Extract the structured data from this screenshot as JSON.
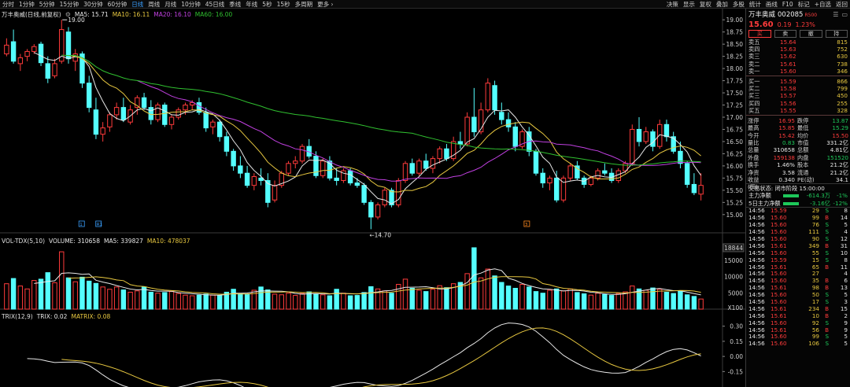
{
  "toolbar": {
    "items": [
      "分时",
      "1分钟",
      "5分钟",
      "15分钟",
      "30分钟",
      "60分钟",
      "日线",
      "周线",
      "月线",
      "10分钟",
      "45日线",
      "季线",
      "年线",
      "5秒",
      "15秒",
      "多周期",
      "更多 ›"
    ],
    "active_index": 6,
    "right_items": [
      "决策",
      "显示",
      "复权",
      "叠加",
      "多股",
      "统计",
      "画线",
      "F10",
      "标记",
      "+自选",
      "返回"
    ]
  },
  "kline": {
    "title": "万丰奥威(日线,前复权)",
    "ma_labels": [
      {
        "text": "MA5: 15.71",
        "color": "#e8e8e8"
      },
      {
        "text": "MA10: 16.11",
        "color": "#e8c840"
      },
      {
        "text": "MA20: 16.10",
        "color": "#c040e0"
      },
      {
        "text": "MA60: 16.00",
        "color": "#30c030"
      }
    ],
    "y_ticks": [
      "19.00",
      "18.75",
      "18.50",
      "18.25",
      "18.00",
      "17.75",
      "17.50",
      "17.25",
      "17.00",
      "16.75",
      "16.50",
      "16.25",
      "16.00",
      "15.75",
      "15.50",
      "15.25",
      "15.00"
    ],
    "high_label": "19.00",
    "low_label": "←14.70",
    "marks": [
      "1",
      "R1",
      "3"
    ]
  },
  "volume": {
    "title": "VOL-TDX(5,10)",
    "labels": [
      {
        "text": "VOLUME: 310658",
        "color": "#e8e8e8"
      },
      {
        "text": "MA5: 339827",
        "color": "#e8e8e8"
      },
      {
        "text": "MA10: 478037",
        "color": "#e8c840"
      }
    ],
    "y_ticks": [
      "18844",
      "15000",
      "10000",
      "5000",
      "X100"
    ]
  },
  "trix": {
    "title": "TRIX(12,9)",
    "labels": [
      {
        "text": "TRIX: 0.02",
        "color": "#e8e8e8"
      },
      {
        "text": "MATRIX: 0.08",
        "color": "#e8c840"
      }
    ],
    "y_ticks": [
      "0.30",
      "0.15",
      "0.00",
      "-0.15"
    ]
  },
  "quote": {
    "name": "万丰奥威",
    "code": "002085",
    "tag": "R500",
    "price": "15.60",
    "change": "0.19",
    "pct": "1.23%",
    "tabs": [
      "买",
      "卖",
      "撤",
      "持"
    ],
    "asks": [
      {
        "label": "卖五",
        "price": "15.64",
        "vol": "815"
      },
      {
        "label": "卖四",
        "price": "15.63",
        "vol": "752"
      },
      {
        "label": "卖三",
        "price": "15.62",
        "vol": "630"
      },
      {
        "label": "卖二",
        "price": "15.61",
        "vol": "738"
      },
      {
        "label": "卖一",
        "price": "15.60",
        "vol": "346"
      }
    ],
    "bids": [
      {
        "label": "买一",
        "price": "15.59",
        "vol": "866"
      },
      {
        "label": "买二",
        "price": "15.58",
        "vol": "799"
      },
      {
        "label": "买三",
        "price": "15.57",
        "vol": "450"
      },
      {
        "label": "买四",
        "price": "15.56",
        "vol": "255"
      },
      {
        "label": "买五",
        "price": "15.55",
        "vol": "328"
      }
    ],
    "stats": [
      {
        "l1": "涨停",
        "v1": "16.95",
        "c1": "red",
        "l2": "跌停",
        "v2": "13.87",
        "c2": "green"
      },
      {
        "l1": "最高",
        "v1": "15.85",
        "c1": "red",
        "l2": "最低",
        "v2": "15.29",
        "c2": "green"
      },
      {
        "l1": "今开",
        "v1": "15.42",
        "c1": "red",
        "l2": "均价",
        "v2": "15.50",
        "c2": "red"
      },
      {
        "l1": "量比",
        "v1": "0.83",
        "c1": "green",
        "l2": "市值",
        "v2": "331.2亿",
        "c2": "white"
      },
      {
        "l1": "总量",
        "v1": "310658",
        "c1": "white",
        "l2": "总额",
        "v2": "4.81亿",
        "c2": "white"
      },
      {
        "l1": "外盘",
        "v1": "159138",
        "c1": "red",
        "l2": "内盘",
        "v2": "151520",
        "c2": "green"
      },
      {
        "l1": "换手",
        "v1": "1.46%",
        "c1": "white",
        "l2": "股本",
        "v2": "21.2亿",
        "c2": "white"
      },
      {
        "l1": "净资",
        "v1": "3.58",
        "c1": "white",
        "l2": "流通",
        "v2": "21.2亿",
        "c2": "white"
      },
      {
        "l1": "收益(四)",
        "v1": "0.340",
        "c1": "white",
        "l2": "PE(动)",
        "v2": "34.1",
        "c2": "white"
      }
    ],
    "status": "交易状态: 闭市阶段 15:00:00",
    "flows": [
      {
        "label": "主力净额",
        "value": "-614.3万",
        "pct": "-1%",
        "color": "#1ec85a"
      },
      {
        "label": "5日主力净额",
        "value": "-3.16亿",
        "pct": "-12%",
        "color": "#1ec85a"
      }
    ],
    "ticks": [
      {
        "t": "14:56",
        "p": "15.59",
        "v": "29",
        "d": "S",
        "n": "8"
      },
      {
        "t": "14:56",
        "p": "15.60",
        "v": "99",
        "d": "B",
        "n": "14"
      },
      {
        "t": "14:56",
        "p": "15.60",
        "v": "76",
        "d": "S",
        "n": "5"
      },
      {
        "t": "14:56",
        "p": "15.60",
        "v": "111",
        "d": "S",
        "n": "4"
      },
      {
        "t": "14:56",
        "p": "15.60",
        "v": "90",
        "d": "S",
        "n": "12"
      },
      {
        "t": "14:56",
        "p": "15.61",
        "v": "349",
        "d": "B",
        "n": "31"
      },
      {
        "t": "14:56",
        "p": "15.60",
        "v": "55",
        "d": "S",
        "n": "10"
      },
      {
        "t": "14:56",
        "p": "15.59",
        "v": "15",
        "d": "S",
        "n": "8"
      },
      {
        "t": "14:56",
        "p": "15.61",
        "v": "65",
        "d": "B",
        "n": "11"
      },
      {
        "t": "14:56",
        "p": "15.60",
        "v": "27",
        "d": "",
        "n": "4"
      },
      {
        "t": "14:56",
        "p": "15.60",
        "v": "35",
        "d": "B",
        "n": "6"
      },
      {
        "t": "14:56",
        "p": "15.61",
        "v": "98",
        "d": "B",
        "n": "13"
      },
      {
        "t": "14:56",
        "p": "15.60",
        "v": "50",
        "d": "S",
        "n": "5"
      },
      {
        "t": "14:56",
        "p": "15.60",
        "v": "17",
        "d": "S",
        "n": "3"
      },
      {
        "t": "14:56",
        "p": "15.61",
        "v": "234",
        "d": "B",
        "n": "15"
      },
      {
        "t": "14:56",
        "p": "15.61",
        "v": "10",
        "d": "B",
        "n": "2"
      },
      {
        "t": "14:56",
        "p": "15.60",
        "v": "92",
        "d": "S",
        "n": "9"
      },
      {
        "t": "14:56",
        "p": "15.61",
        "v": "56",
        "d": "B",
        "n": "9"
      },
      {
        "t": "14:56",
        "p": "15.60",
        "v": "99",
        "d": "S",
        "n": "5"
      },
      {
        "t": "14:56",
        "p": "15.60",
        "v": "106",
        "d": "S",
        "n": "5"
      }
    ]
  },
  "chart_data": {
    "type": "candlestick",
    "y_range": [
      14.9,
      19.1
    ],
    "ohlc": [
      [
        18.3,
        18.62,
        18.25,
        18.48
      ],
      [
        18.55,
        18.8,
        18.1,
        18.15
      ],
      [
        18.1,
        18.3,
        17.95,
        18.22
      ],
      [
        18.25,
        18.4,
        18.15,
        18.35
      ],
      [
        18.35,
        18.5,
        18.3,
        18.45
      ],
      [
        18.5,
        18.55,
        18.05,
        18.12
      ],
      [
        18.1,
        18.25,
        17.7,
        17.8
      ],
      [
        17.85,
        18.2,
        17.8,
        18.1
      ],
      [
        18.15,
        19.0,
        18.1,
        18.8
      ],
      [
        18.75,
        18.85,
        18.1,
        18.2
      ],
      [
        18.15,
        18.4,
        17.95,
        18.3
      ],
      [
        18.3,
        18.35,
        17.6,
        17.7
      ],
      [
        17.7,
        17.85,
        17.1,
        17.2
      ],
      [
        17.15,
        17.4,
        16.55,
        16.65
      ],
      [
        16.65,
        16.9,
        16.5,
        16.78
      ],
      [
        16.8,
        17.1,
        16.7,
        17.05
      ],
      [
        17.05,
        17.3,
        16.95,
        17.2
      ],
      [
        17.2,
        17.4,
        16.9,
        16.95
      ],
      [
        16.9,
        17.25,
        16.85,
        17.15
      ],
      [
        17.2,
        17.45,
        17.05,
        17.4
      ],
      [
        17.4,
        17.5,
        17.15,
        17.2
      ],
      [
        17.2,
        17.35,
        16.85,
        16.95
      ],
      [
        16.95,
        17.3,
        16.9,
        17.25
      ],
      [
        17.25,
        17.3,
        16.8,
        16.85
      ],
      [
        16.85,
        17.05,
        16.75,
        17.0
      ],
      [
        17.0,
        17.2,
        16.95,
        17.15
      ],
      [
        17.15,
        17.3,
        17.05,
        17.25
      ],
      [
        17.25,
        17.35,
        17.15,
        17.3
      ],
      [
        17.3,
        17.4,
        17.05,
        17.1
      ],
      [
        17.1,
        17.2,
        16.7,
        16.78
      ],
      [
        16.8,
        16.95,
        16.65,
        16.9
      ],
      [
        16.9,
        16.95,
        16.5,
        16.6
      ],
      [
        16.6,
        16.7,
        16.2,
        16.3
      ],
      [
        16.3,
        16.35,
        15.9,
        16.0
      ],
      [
        16.0,
        16.2,
        15.75,
        15.85
      ],
      [
        15.85,
        16.0,
        15.55,
        15.6
      ],
      [
        15.6,
        15.85,
        15.5,
        15.78
      ],
      [
        15.75,
        15.95,
        15.6,
        15.7
      ],
      [
        15.7,
        15.85,
        15.15,
        15.25
      ],
      [
        15.3,
        15.7,
        15.25,
        15.6
      ],
      [
        15.6,
        15.9,
        15.55,
        15.85
      ],
      [
        15.85,
        16.1,
        15.8,
        16.05
      ],
      [
        16.05,
        16.2,
        15.95,
        16.1
      ],
      [
        16.1,
        16.45,
        16.05,
        16.4
      ],
      [
        16.4,
        16.55,
        16.15,
        16.2
      ],
      [
        16.2,
        16.3,
        15.75,
        15.8
      ],
      [
        15.8,
        16.15,
        15.75,
        16.1
      ],
      [
        16.1,
        16.2,
        15.7,
        15.75
      ],
      [
        15.75,
        15.95,
        15.6,
        15.7
      ],
      [
        15.7,
        15.95,
        15.65,
        15.9
      ],
      [
        15.9,
        15.95,
        15.6,
        15.65
      ],
      [
        15.65,
        15.75,
        15.55,
        15.6
      ],
      [
        15.6,
        15.65,
        15.2,
        15.25
      ],
      [
        15.25,
        15.3,
        14.7,
        14.95
      ],
      [
        14.95,
        15.25,
        14.9,
        15.2
      ],
      [
        15.2,
        15.55,
        15.15,
        15.5
      ],
      [
        15.5,
        15.55,
        15.15,
        15.2
      ],
      [
        15.2,
        15.75,
        15.15,
        15.7
      ],
      [
        15.7,
        16.1,
        15.65,
        16.05
      ],
      [
        16.05,
        16.15,
        15.8,
        15.85
      ],
      [
        15.85,
        16.15,
        15.8,
        16.1
      ],
      [
        16.1,
        16.25,
        15.9,
        15.95
      ],
      [
        15.95,
        16.2,
        15.85,
        16.15
      ],
      [
        16.15,
        16.4,
        16.05,
        16.35
      ],
      [
        16.35,
        16.45,
        16.1,
        16.15
      ],
      [
        16.15,
        16.6,
        16.1,
        16.5
      ],
      [
        16.5,
        16.7,
        16.35,
        16.45
      ],
      [
        16.45,
        17.1,
        16.4,
        17.0
      ],
      [
        17.0,
        17.6,
        16.6,
        16.7
      ],
      [
        16.7,
        17.3,
        16.65,
        17.15
      ],
      [
        17.15,
        17.8,
        17.1,
        17.7
      ],
      [
        17.65,
        17.75,
        17.05,
        17.15
      ],
      [
        17.1,
        17.3,
        16.85,
        16.95
      ],
      [
        16.95,
        17.1,
        16.7,
        16.8
      ],
      [
        16.8,
        16.9,
        16.3,
        16.4
      ],
      [
        16.4,
        16.75,
        16.35,
        16.7
      ],
      [
        16.7,
        16.8,
        16.2,
        16.3
      ],
      [
        16.3,
        16.35,
        15.8,
        15.85
      ],
      [
        15.85,
        15.95,
        15.55,
        15.65
      ],
      [
        15.65,
        15.8,
        15.5,
        15.75
      ],
      [
        15.75,
        15.9,
        15.25,
        15.3
      ],
      [
        15.3,
        15.8,
        15.25,
        15.75
      ],
      [
        15.75,
        16.05,
        15.7,
        16.0
      ],
      [
        16.0,
        16.1,
        15.7,
        15.75
      ],
      [
        15.75,
        15.8,
        15.55,
        15.62
      ],
      [
        15.62,
        15.8,
        15.58,
        15.75
      ],
      [
        15.75,
        15.95,
        15.7,
        15.9
      ],
      [
        15.9,
        16.05,
        15.8,
        15.85
      ],
      [
        15.85,
        15.95,
        15.65,
        15.7
      ],
      [
        15.7,
        15.95,
        15.65,
        15.9
      ],
      [
        15.9,
        16.1,
        15.85,
        16.05
      ],
      [
        16.05,
        16.85,
        16.0,
        16.75
      ],
      [
        16.75,
        17.0,
        16.4,
        16.5
      ],
      [
        16.5,
        16.8,
        16.45,
        16.7
      ],
      [
        16.7,
        16.75,
        16.3,
        16.4
      ],
      [
        16.4,
        16.95,
        16.35,
        16.85
      ],
      [
        16.85,
        16.95,
        16.5,
        16.6
      ],
      [
        16.6,
        16.7,
        16.25,
        16.3
      ],
      [
        16.3,
        16.5,
        15.95,
        16.05
      ],
      [
        16.05,
        16.1,
        15.55,
        15.62
      ],
      [
        15.62,
        15.85,
        15.4,
        15.45
      ],
      [
        15.42,
        15.85,
        15.29,
        15.6
      ]
    ],
    "volume": [
      7800,
      9400,
      7100,
      6200,
      8800,
      9200,
      11200,
      8100,
      17600,
      9600,
      8400,
      9800,
      8600,
      7900,
      6800,
      6100,
      6800,
      5900,
      5200,
      5600,
      6800,
      5200,
      4900,
      5100,
      5400,
      4800,
      4300,
      4100,
      4300,
      4600,
      4300,
      4100,
      5200,
      6100,
      4800,
      4600,
      5800,
      6800,
      5900,
      4600,
      4400,
      4900,
      4200,
      4800,
      5300,
      4700,
      4400,
      4100,
      6100,
      4900,
      4100,
      4200,
      5100,
      6900,
      6200,
      5600,
      4900,
      7600,
      9200,
      6400,
      5800,
      5400,
      6100,
      7200,
      6600,
      7800,
      8200,
      10900,
      18844,
      9600,
      12300,
      10200,
      8200,
      7100,
      6400,
      7600,
      6800,
      5400,
      4900,
      5800,
      6200,
      5600,
      6200,
      5100,
      4700,
      4300,
      4900,
      4500,
      4200,
      4800,
      5300,
      7100,
      6200,
      5800,
      6500,
      6100,
      5200,
      4800,
      5600,
      4400,
      3900,
      3106
    ]
  }
}
